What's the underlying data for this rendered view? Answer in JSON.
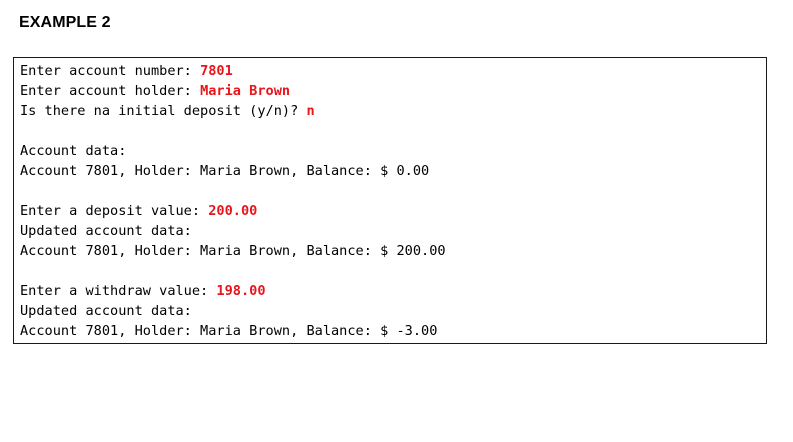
{
  "title": "EXAMPLE 2",
  "colors": {
    "user_input": "#e8151b",
    "text": "#000000",
    "border": "#1a1a1a"
  },
  "console": {
    "prompt_account_number": "Enter account number: ",
    "input_account_number": "7801",
    "prompt_account_holder": "Enter account holder: ",
    "input_account_holder": "Maria Brown",
    "prompt_initial_deposit": "Is there na initial deposit (y/n)? ",
    "input_initial_deposit": "n",
    "account_data_label": "Account data:",
    "account_line_1": "Account 7801, Holder: Maria Brown, Balance: $ 0.00",
    "prompt_deposit": "Enter a deposit value: ",
    "input_deposit": "200.00",
    "updated_label_1": "Updated account data:",
    "account_line_2": "Account 7801, Holder: Maria Brown, Balance: $ 200.00",
    "prompt_withdraw": "Enter a withdraw value: ",
    "input_withdraw": "198.00",
    "updated_label_2": "Updated account data:",
    "account_line_3": "Account 7801, Holder: Maria Brown, Balance: $ -3.00"
  }
}
